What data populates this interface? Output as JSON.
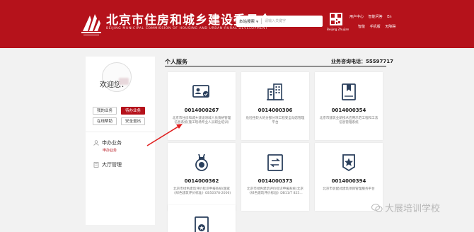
{
  "header": {
    "title": "北京市住房和城乡建设委员会",
    "subtitle": "BEIJING MUNICIPAL COMMISSION OF HOUSING AND URBAN-RURAL DEVELOPMENT",
    "search": {
      "select_value": "本站搜索",
      "placeholder": "请输入关键字"
    },
    "qr_label": "Beijing Zhujian",
    "links_row1": [
      "用户中心",
      "智能问答",
      "En"
    ],
    "links_row2": [
      "智能",
      "手机版",
      "无障碍"
    ],
    "brand_color": "#b5121b"
  },
  "sidebar": {
    "welcome": "欢迎您：",
    "buttons": [
      {
        "label": "我的业务"
      },
      {
        "label": "待办业务"
      },
      {
        "label": "在线帮助"
      },
      {
        "label": "安全退出"
      }
    ],
    "menu": [
      {
        "label": "申办业务",
        "icon": "user-icon",
        "sub": "申办业务"
      },
      {
        "label": "大厅管理",
        "icon": "document-icon"
      }
    ]
  },
  "main": {
    "section_title": "个人服务",
    "hotline": "业务咨询电话：55597717",
    "cards": [
      {
        "code": "0014000267",
        "icon": "id-card-check-icon",
        "desc": "北京市住房和城乡建设领域人员资格管理信息系统(施工现场专业人员职业培训)"
      },
      {
        "code": "0014000306",
        "icon": "building-icon",
        "desc": "危险性较大的分部分项工程安全动态管理平台"
      },
      {
        "code": "0014000354",
        "icon": "bookmark-book-icon",
        "desc": "北京市建筑业新技术应用示范工程和工法信息管理系统"
      },
      {
        "code": "0014000362",
        "icon": "medal-icon",
        "desc": "北京市绿色建筑评价标识申报系统(国家《绿色建筑评价标准》GB50378-2006)"
      },
      {
        "code": "0014000373",
        "icon": "exchange-document-icon",
        "desc": "北京市绿色建筑评价标识申报系统(北京《绿色建筑评价标准》DB11/T 825..."
      },
      {
        "code": "0014000394",
        "icon": "star-badge-icon",
        "desc": "北京市装配式建筑项目管理服务平台"
      },
      {
        "code": "",
        "icon": "document-star-icon",
        "desc": ""
      }
    ]
  },
  "watermark": "大展培训学校"
}
